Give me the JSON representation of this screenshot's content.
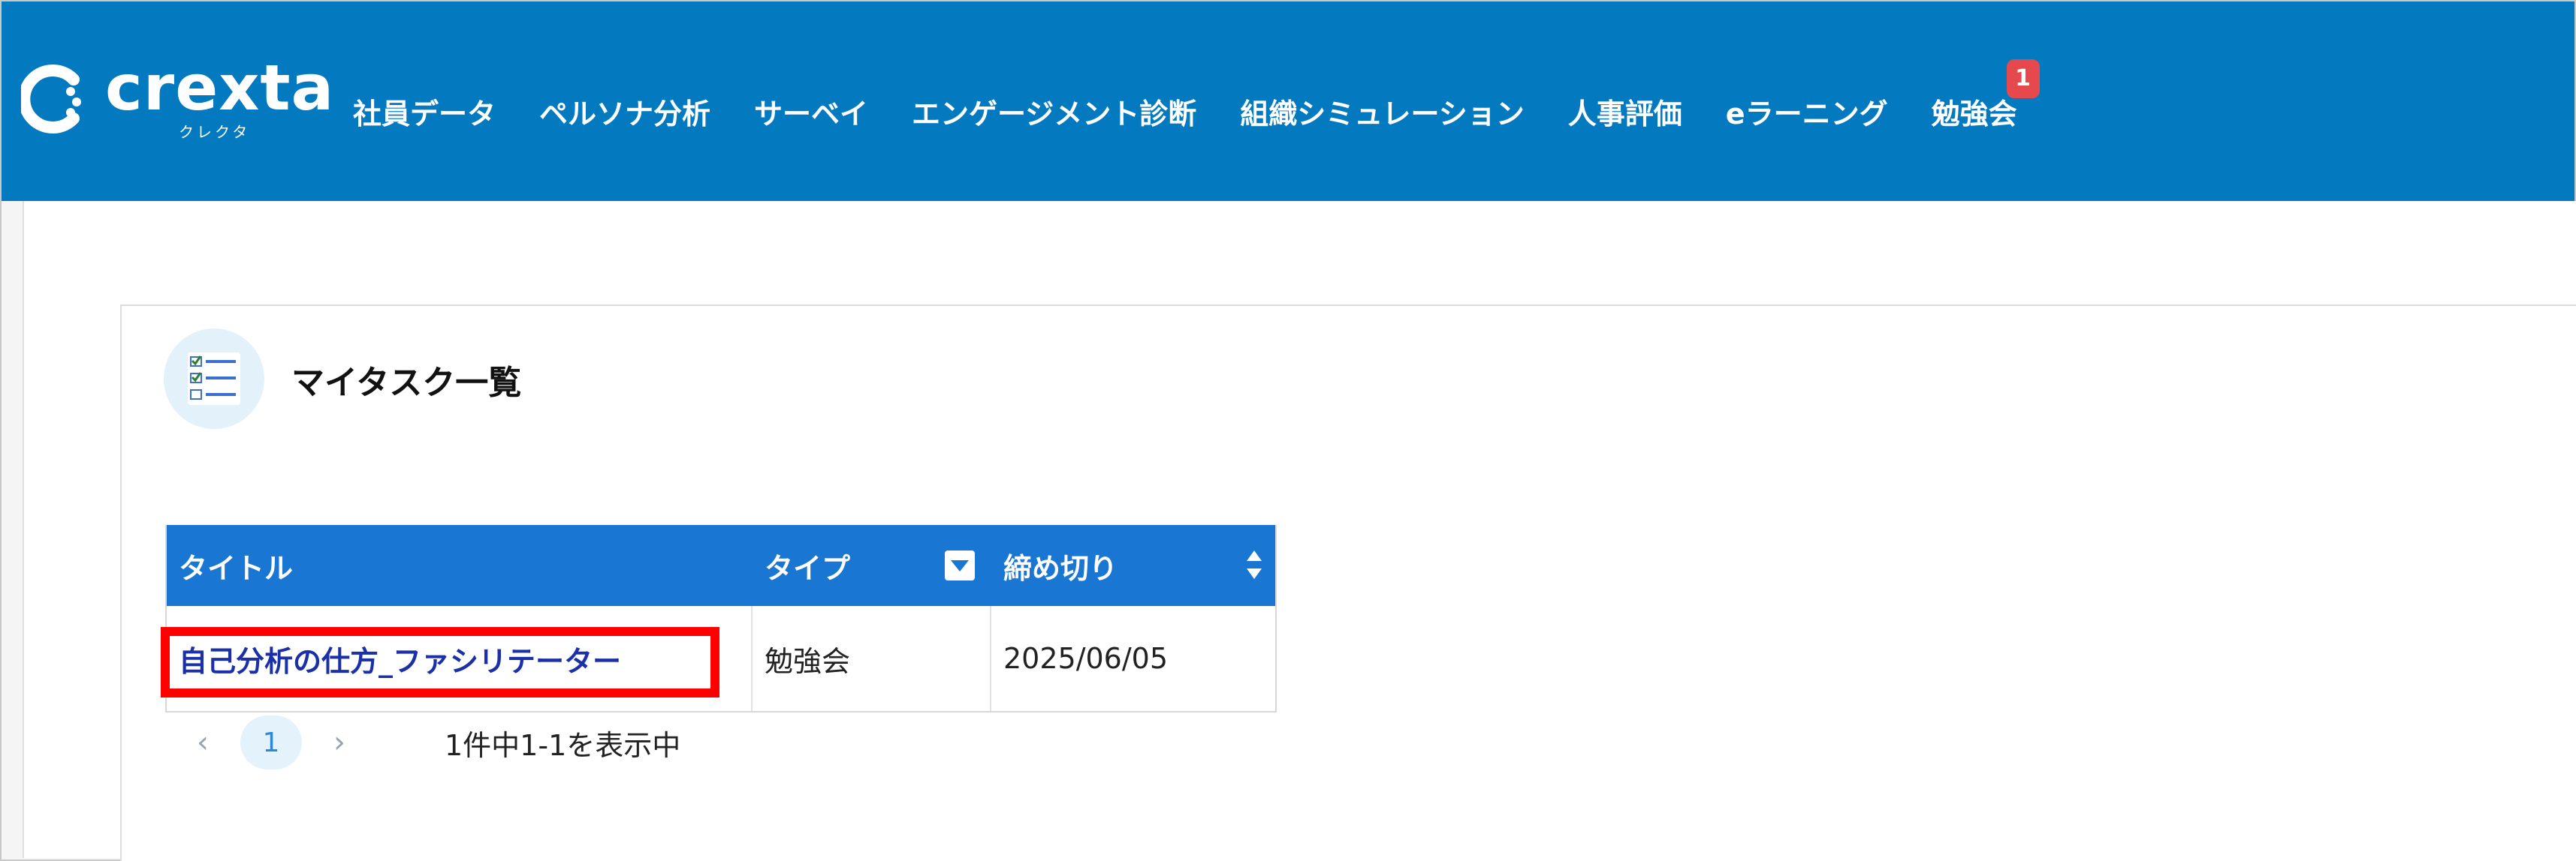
{
  "app": {
    "logo_text": "crexta",
    "logo_sub": "クレクタ"
  },
  "nav": {
    "items": [
      {
        "label": "社員データ"
      },
      {
        "label": "ペルソナ分析"
      },
      {
        "label": "サーベイ"
      },
      {
        "label": "エンゲージメント診断"
      },
      {
        "label": "組織シミュレーション"
      },
      {
        "label": "人事評価"
      },
      {
        "label": "eラーニング"
      },
      {
        "label": "勉強会",
        "badge": "1"
      }
    ]
  },
  "page": {
    "title": "マイタスク一覧",
    "icon": "checklist-icon"
  },
  "table": {
    "columns": [
      "タイトル",
      "タイプ",
      "締め切り"
    ],
    "rows": [
      {
        "title": "自己分析の仕方_ファシリテーター",
        "type": "勉強会",
        "deadline": "2025/06/05"
      }
    ]
  },
  "pagination": {
    "prev": "‹",
    "current": "1",
    "next": "›",
    "info": "1件中1-1を表示中"
  },
  "colors": {
    "header_bg": "#0379c0",
    "table_header_bg": "#1976d2",
    "badge": "#e5484d",
    "highlight": "#ff0000",
    "link": "#1a2fa8"
  }
}
